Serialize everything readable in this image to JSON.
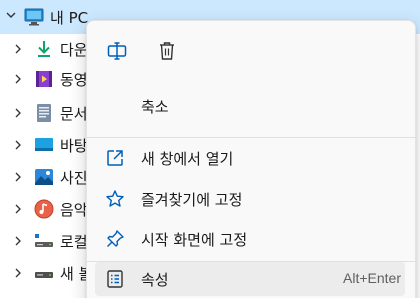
{
  "nav_tree": {
    "root": {
      "label": "내 PC",
      "icon": "monitor-icon",
      "expanded": true
    },
    "items": [
      {
        "label": "다운",
        "icon": "download-arrow-icon"
      },
      {
        "label": "동영",
        "icon": "video-folder-icon"
      },
      {
        "label": "문서",
        "icon": "document-icon"
      },
      {
        "label": "바탕",
        "icon": "desktop-icon"
      },
      {
        "label": "사진",
        "icon": "pictures-icon"
      },
      {
        "label": "음악",
        "icon": "music-icon"
      },
      {
        "label": "로컬",
        "icon": "local-disk-icon"
      },
      {
        "label": "새 볼",
        "icon": "drive-icon"
      }
    ]
  },
  "context_menu": {
    "quick_actions": [
      {
        "name": "rename",
        "icon": "rename-icon"
      },
      {
        "name": "delete",
        "icon": "trash-icon"
      }
    ],
    "collapse_label": "축소",
    "items": [
      {
        "label": "새 창에서 열기",
        "icon": "open-new-window-icon"
      },
      {
        "label": "즐겨찾기에 고정",
        "icon": "star-icon"
      },
      {
        "label": "시작 화면에 고정",
        "icon": "pin-icon"
      }
    ],
    "properties": {
      "label": "속성",
      "shortcut": "Alt+Enter",
      "icon": "properties-icon"
    }
  },
  "colors": {
    "selection": "#cce8ff",
    "accent": "#005fb8",
    "menu_background": "#f9f9f9",
    "hover": "#ececec"
  }
}
